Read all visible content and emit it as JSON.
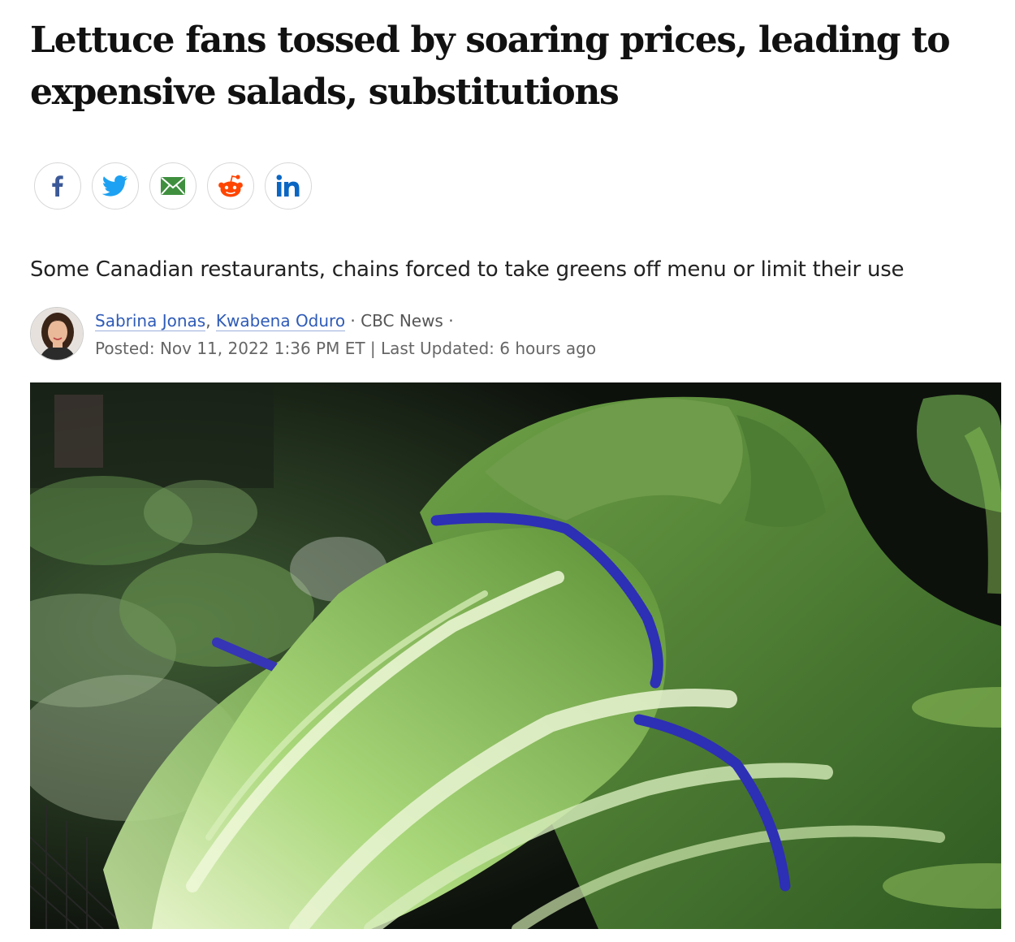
{
  "article": {
    "headline": "Lettuce fans tossed by soaring prices, leading to expensive salads, substitutions",
    "deck": "Some Canadian restaurants, chains forced to take greens off menu or limit their use"
  },
  "share": {
    "icons": [
      "facebook-icon",
      "twitter-icon",
      "email-icon",
      "reddit-icon",
      "linkedin-icon"
    ],
    "colors": {
      "facebook": "#3b5998",
      "twitter": "#1da1f2",
      "email": "#3f8f3f",
      "reddit": "#ff4500",
      "linkedin": "#0a66c2"
    }
  },
  "byline": {
    "author1": "Sabrina Jonas",
    "comma": ",",
    "author2": "Kwabena Oduro",
    "separator": " · ",
    "source": "CBC News",
    "trailing_dot": " ·",
    "posted": "Posted: Nov 11, 2022 1:36 PM ET | Last Updated: 6 hours ago"
  },
  "colors": {
    "link": "#2f5bb7",
    "lettuce": "#8ec55a",
    "band": "#2d2fb5",
    "background_dark": "#0d110c"
  }
}
